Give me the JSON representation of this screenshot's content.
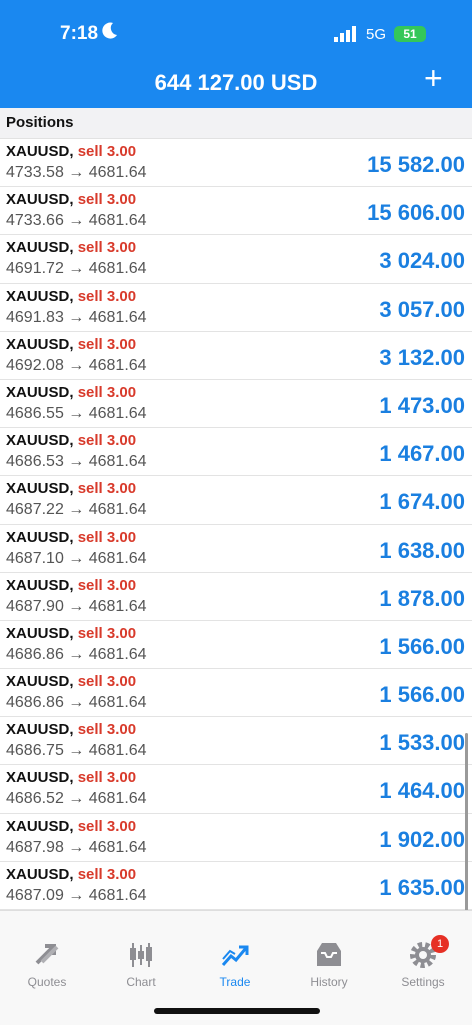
{
  "status_bar": {
    "time": "7:18",
    "network": "5G",
    "battery": "51"
  },
  "header": {
    "balance": "644 127.00 USD",
    "add_label": "+"
  },
  "section_title": "Positions",
  "positions": [
    {
      "symbol": "XAUUSD,",
      "side": "sell 3.00",
      "prices": "4733.58 → 4681.64",
      "profit": "15 582.00"
    },
    {
      "symbol": "XAUUSD,",
      "side": "sell 3.00",
      "prices": "4733.66 → 4681.64",
      "profit": "15 606.00"
    },
    {
      "symbol": "XAUUSD,",
      "side": "sell 3.00",
      "prices": "4691.72 → 4681.64",
      "profit": "3 024.00"
    },
    {
      "symbol": "XAUUSD,",
      "side": "sell 3.00",
      "prices": "4691.83 → 4681.64",
      "profit": "3 057.00"
    },
    {
      "symbol": "XAUUSD,",
      "side": "sell 3.00",
      "prices": "4692.08 → 4681.64",
      "profit": "3 132.00"
    },
    {
      "symbol": "XAUUSD,",
      "side": "sell 3.00",
      "prices": "4686.55 → 4681.64",
      "profit": "1 473.00"
    },
    {
      "symbol": "XAUUSD,",
      "side": "sell 3.00",
      "prices": "4686.53 → 4681.64",
      "profit": "1 467.00"
    },
    {
      "symbol": "XAUUSD,",
      "side": "sell 3.00",
      "prices": "4687.22 → 4681.64",
      "profit": "1 674.00"
    },
    {
      "symbol": "XAUUSD,",
      "side": "sell 3.00",
      "prices": "4687.10 → 4681.64",
      "profit": "1 638.00"
    },
    {
      "symbol": "XAUUSD,",
      "side": "sell 3.00",
      "prices": "4687.90 → 4681.64",
      "profit": "1 878.00"
    },
    {
      "symbol": "XAUUSD,",
      "side": "sell 3.00",
      "prices": "4686.86 → 4681.64",
      "profit": "1 566.00"
    },
    {
      "symbol": "XAUUSD,",
      "side": "sell 3.00",
      "prices": "4686.86 → 4681.64",
      "profit": "1 566.00"
    },
    {
      "symbol": "XAUUSD,",
      "side": "sell 3.00",
      "prices": "4686.75 → 4681.64",
      "profit": "1 533.00"
    },
    {
      "symbol": "XAUUSD,",
      "side": "sell 3.00",
      "prices": "4686.52 → 4681.64",
      "profit": "1 464.00"
    },
    {
      "symbol": "XAUUSD,",
      "side": "sell 3.00",
      "prices": "4687.98 → 4681.64",
      "profit": "1 902.00"
    },
    {
      "symbol": "XAUUSD,",
      "side": "sell 3.00",
      "prices": "4687.09 → 4681.64",
      "profit": "1 635.00"
    }
  ],
  "tabs": [
    {
      "label": "Quotes",
      "icon": "quotes-icon"
    },
    {
      "label": "Chart",
      "icon": "chart-icon"
    },
    {
      "label": "Trade",
      "icon": "trade-icon",
      "active": true
    },
    {
      "label": "History",
      "icon": "history-icon"
    },
    {
      "label": "Settings",
      "icon": "settings-icon",
      "badge": "1"
    }
  ],
  "colors": {
    "accent": "#1a88f0",
    "sell": "#d83a2b",
    "profit": "#1a7fe0"
  }
}
